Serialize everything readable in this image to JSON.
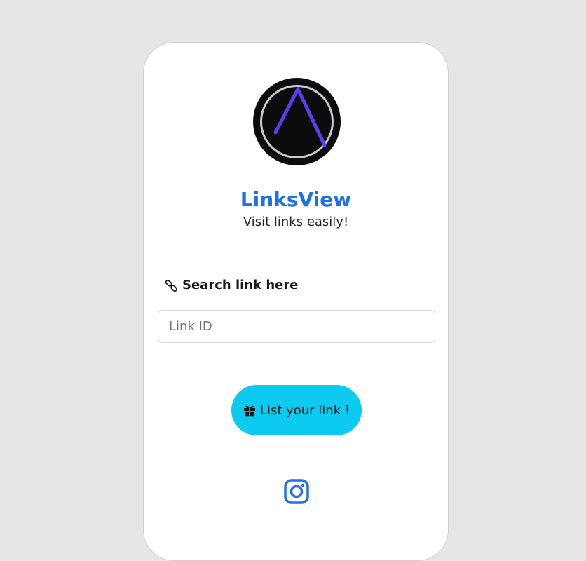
{
  "brand": {
    "name": "LinksView",
    "tagline": "Visit links easily!",
    "logo_icon": "triangle-logo-icon"
  },
  "search": {
    "label": "Search link here",
    "icon": "link-icon",
    "placeholder": "Link ID",
    "value": ""
  },
  "cta": {
    "label": "List your link !",
    "icon": "gift-icon"
  },
  "social": {
    "instagram_icon": "instagram-icon"
  },
  "colors": {
    "page_background": "#e6e6e6",
    "brand_blue": "#1f6fe6",
    "cta_cyan": "#0dcaf0",
    "logo_accent": "#5a3df0"
  }
}
